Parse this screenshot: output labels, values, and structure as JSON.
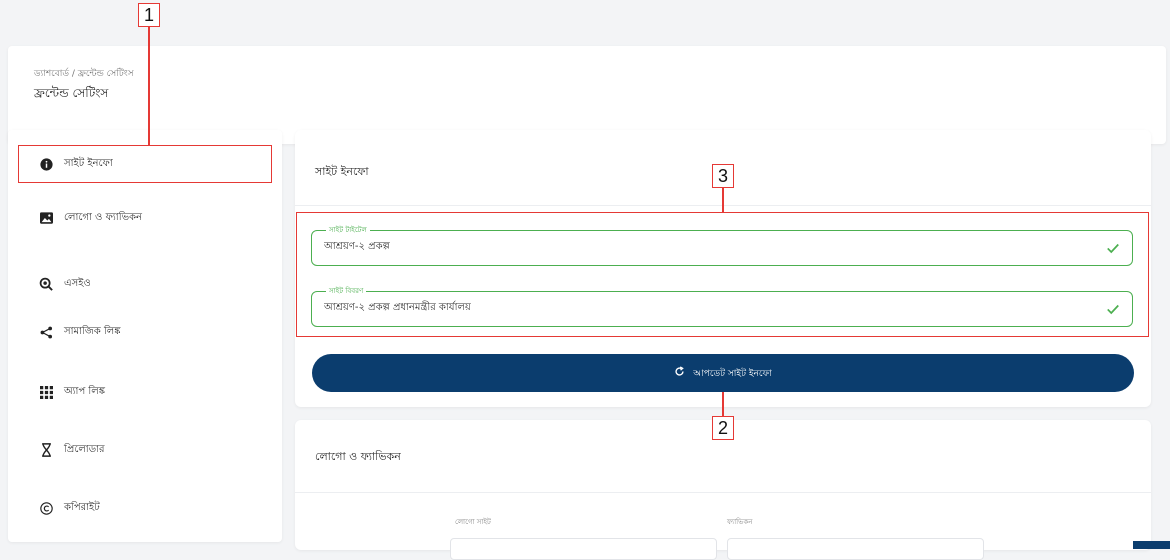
{
  "header": {
    "breadcrumb": "ড্যাশবোর্ড / ফ্রন্টেন্ড সেটিংস",
    "title": "ফ্রন্টেন্ড সেটিংস"
  },
  "sidebar": {
    "items": [
      {
        "label": "সাইট ইনফো",
        "icon": "info-circle-icon"
      },
      {
        "label": "লোগো ও ফ্যাভিকন",
        "icon": "image-icon"
      },
      {
        "label": "এসইও",
        "icon": "seo-search-icon"
      },
      {
        "label": "সামাজিক লিঙ্ক",
        "icon": "share-icon"
      },
      {
        "label": "অ্যাপ লিঙ্ক",
        "icon": "apps-grid-icon"
      },
      {
        "label": "প্রিলোডার",
        "icon": "hourglass-icon"
      },
      {
        "label": "কপিরাইট",
        "icon": "copyright-icon"
      }
    ]
  },
  "site_info": {
    "title": "সাইট ইনফো",
    "site_title_label": "সাইট টাইটেল",
    "site_title_value": "আশ্রয়ণ-২ প্রকল্প",
    "site_desc_label": "সাইট বিবরণ",
    "site_desc_value": "আশ্রয়ণ-২ প্রকল্প প্রধানমন্ত্রীর কার্যালয়",
    "update_button": "আপডেট সাইট ইনফো"
  },
  "logo_favicon": {
    "title": "লোগো ও ফ্যাভিকন",
    "logo_label": "লোগো সাইট",
    "favicon_label": "ফ্যাভিকন"
  },
  "annotations": [
    "1",
    "2",
    "3"
  ],
  "colors": {
    "primary": "#0b3d6e",
    "success": "#4caf50",
    "annotation": "#e53935"
  }
}
